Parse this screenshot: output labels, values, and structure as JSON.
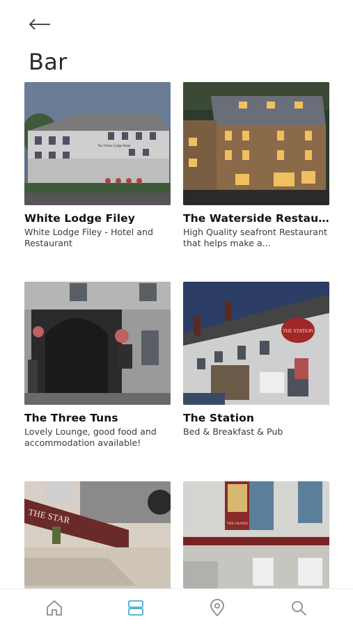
{
  "header": {
    "back_icon": "arrow-left-icon",
    "title": "Bar"
  },
  "cards": [
    {
      "title": "White Lodge Filey",
      "description": "White Lodge Filey - Hotel and Restaurant"
    },
    {
      "title": "The Waterside Restaur...",
      "description": "High Quality seafront Restaurant that helps make a..."
    },
    {
      "title": "The Three Tuns",
      "description": "Lovely Lounge, good food and accommodation available!"
    },
    {
      "title": "The Station",
      "description": "Bed & Breakfast & Pub"
    },
    {
      "title": "",
      "description": ""
    },
    {
      "title": "",
      "description": ""
    }
  ],
  "image_text": {
    "white_lodge_sign": "The White Lodge Hotel",
    "station_sign": "THE STATION",
    "star_sign": "THE STAR",
    "grapes_sign": "THE GRAPES"
  },
  "tabbar": {
    "items": [
      "home-icon",
      "list-icon",
      "location-pin-icon",
      "search-icon"
    ],
    "active_index": 1,
    "active_color": "#5ab4d6",
    "inactive_color": "#8a8a8a"
  }
}
